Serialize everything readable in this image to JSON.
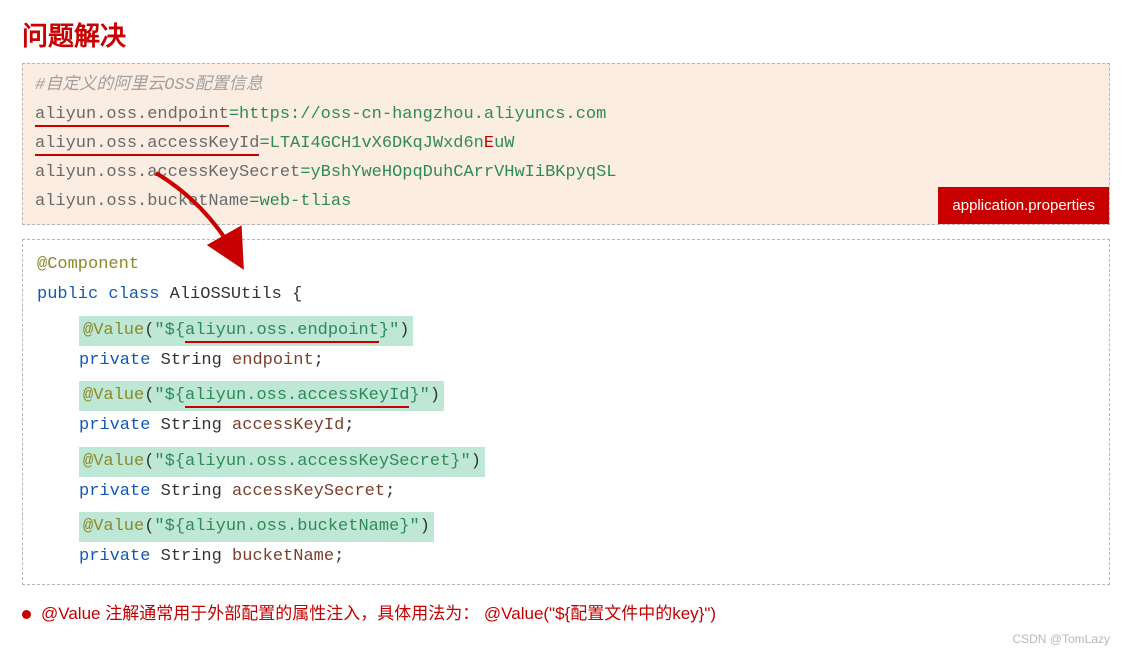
{
  "title": "问题解决",
  "props": {
    "comment": "#自定义的阿里云OSS配置信息",
    "k1": "aliyun.oss.endpoint",
    "v1": "=https://oss-cn-hangzhou.aliyuncs.com",
    "k2": "aliyun.oss.accessKeyId",
    "v2a": "=LTAI4GCH1vX6DKqJWxd6n",
    "v2b": "E",
    "v2c": "uW",
    "k3": "aliyun.oss.accessKeySecret",
    "v3": "=yBshYweHOpqDuhCArrVHwIiBKpyqSL",
    "k4": "aliyun.oss.bucketName",
    "v4": "=web-tlias",
    "badge": "application.properties"
  },
  "code": {
    "anno_component": "@Component",
    "kw_public": "public",
    "kw_class": "class",
    "cls_name": "AliOSSUtils",
    "brace_open": "{",
    "at_value": "@Value",
    "p_open": "(",
    "p_close": ")",
    "q": "\"",
    "d_open": "${",
    "d_close": "}",
    "key1": "aliyun.oss.endpoint",
    "key2": "aliyun.oss.accessKeyId",
    "key3": "aliyun.oss.accessKeySecret",
    "key4": "aliyun.oss.bucketName",
    "kw_private": "private",
    "type_string": "String",
    "f1": "endpoint",
    "f2": "accessKeyId",
    "f3": "accessKeySecret",
    "f4": "bucketName",
    "semi": ";"
  },
  "bullet": "@Value 注解通常用于外部配置的属性注入，具体用法为： @Value(\"${配置文件中的key}\")",
  "footer": "CSDN @TomLazy"
}
